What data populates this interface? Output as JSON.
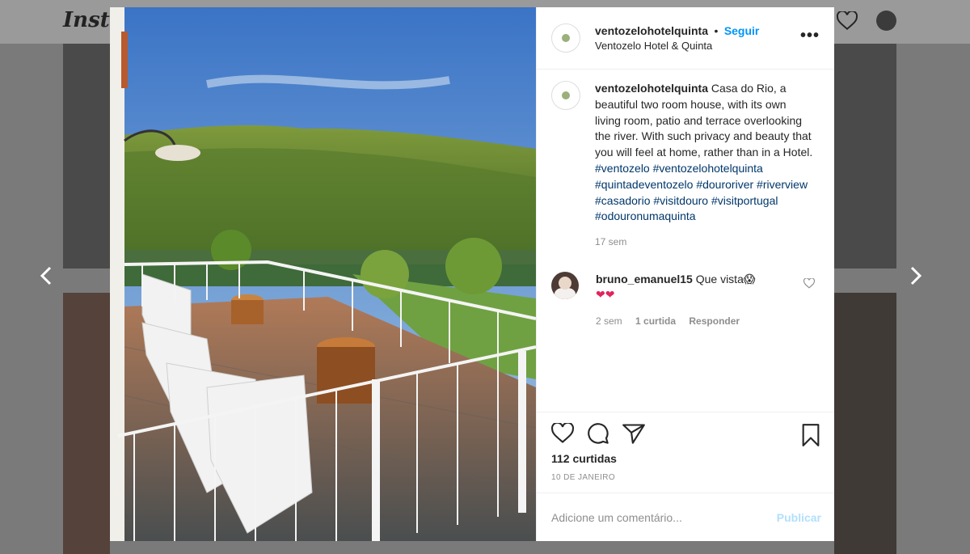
{
  "background": {
    "logo_text": "Insta",
    "nav_prev_icon": "chevron-left-icon",
    "nav_next_icon": "chevron-right-icon"
  },
  "post": {
    "header": {
      "username": "ventozelohotelquinta",
      "separator": "•",
      "follow_label": "Seguir",
      "location": "Ventozelo Hotel & Quinta",
      "more_icon": "more-options-icon"
    },
    "caption": {
      "username": "ventozelohotelquinta",
      "text": "Casa do Rio, a beautiful two room house, with its own living room, patio and terrace overlooking the river. With such privacy and beauty that you will feel at home, rather than in a Hotel.",
      "hashtags": [
        "#ventozelo",
        "#ventozelohotelquinta",
        "#quintadeventozelo",
        "#douroriver",
        "#douroriver",
        "#riverview",
        "#casadorio",
        "#visitdouro",
        "#visitportugal",
        "#odouronumaquinta"
      ],
      "time": "17 sem"
    },
    "comments": [
      {
        "username": "bruno_emanuel15",
        "text": "Que vista😱",
        "hearts": "❤❤",
        "time": "2 sem",
        "likes": "1 curtida",
        "reply_label": "Responder"
      }
    ],
    "likes_text": "112 curtidas",
    "date": "10 DE JANEIRO",
    "comment_placeholder": "Adicione um comentário...",
    "publish_label": "Publicar",
    "icons": {
      "like": "heart-icon",
      "comment": "comment-icon",
      "share": "share-icon",
      "save": "bookmark-icon"
    }
  }
}
